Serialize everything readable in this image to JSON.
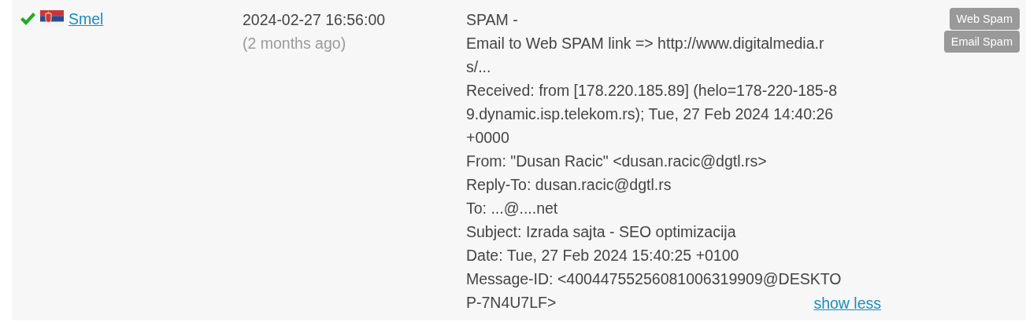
{
  "report": {
    "verified": true,
    "reporter": "Smel",
    "date": "2024-02-27 16:56:00",
    "relative_date": "(2 months ago)",
    "message_lines": [
      "SPAM -",
      "Email to Web SPAM link => http://www.digitalmedia.r",
      "s/...",
      "Received: from [178.220.185.89] (helo=178-220-185-8",
      "9.dynamic.isp.telekom.rs); Tue, 27 Feb 2024 14:40:26",
      "+0000",
      "From: \"Dusan Racic\" <dusan.racic@dgtl.rs>",
      "Reply-To: dusan.racic@dgtl.rs",
      "To: ...@....net",
      "Subject: Izrada sajta - SEO optimizacija",
      "Date: Tue, 27 Feb 2024 15:40:25 +0100",
      "Message-ID: <40044755256081006319909@DESKTO",
      "P-7N4U7LF>"
    ],
    "toggle_link": "show less",
    "tags": [
      "Web Spam",
      "Email Spam"
    ]
  }
}
